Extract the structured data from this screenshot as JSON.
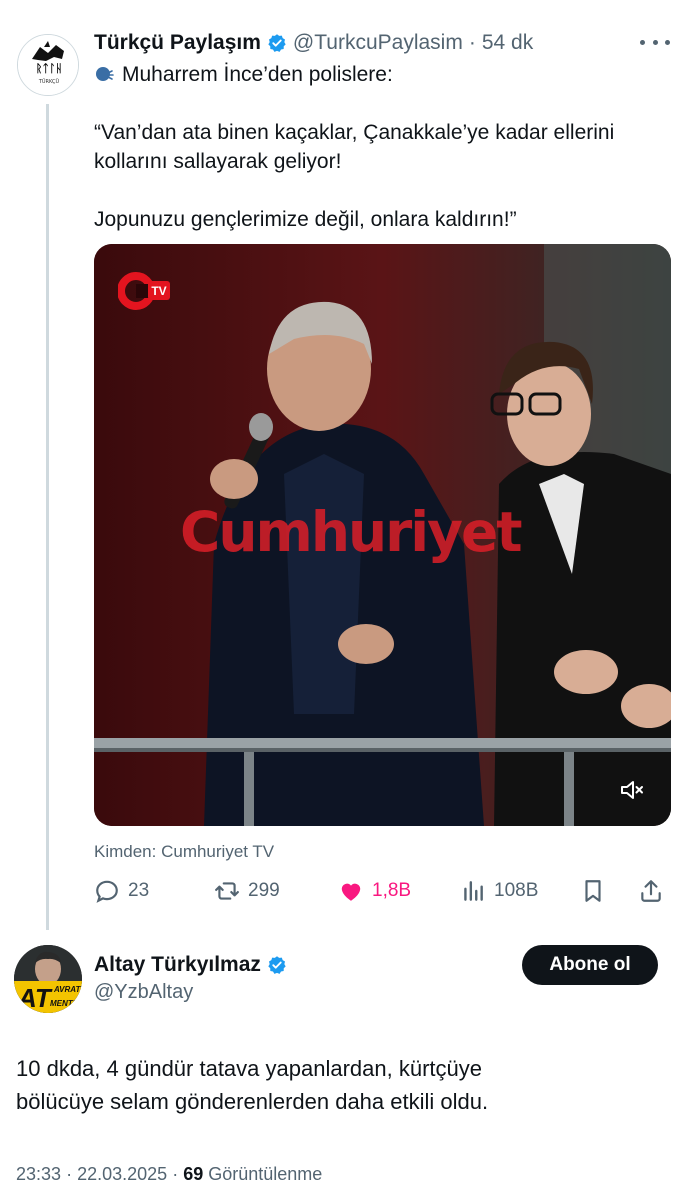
{
  "tweet": {
    "author_name": "Türkçü Paylaşım",
    "handle": "@TurkcuPaylasim",
    "separator": "·",
    "time": "54 dk",
    "avatar_text": "TÜRKÇÜ",
    "text_lines": [
      "Muharrem İnce’den polislere:",
      "",
      "“Van’dan ata binen kaçaklar, Çanakkale’ye kadar ellerini",
      "kollarını sallayarak geliyor!",
      "",
      "Jopunuzu gençlerimize değil, onlara kaldırın!”"
    ],
    "media": {
      "channel_logo_text": "TV",
      "watermark": "Cumhuriyet"
    },
    "source": "Kimden: Cumhuriyet TV",
    "actions": {
      "replies": "23",
      "reposts": "299",
      "likes": "1,8B",
      "views": "108B"
    },
    "colors": {
      "like": "#f91880",
      "verified": "#1d9bf0",
      "muted": "#536471"
    }
  },
  "quote_tweet": {
    "author_name": "Altay Türkyılmaz",
    "handle": "@YzbAltay",
    "follow_label": "Abone ol",
    "avatar_text": {
      "big": "AT",
      "top": "AVRAT",
      "bottom": "MENTION"
    },
    "body_lines": [
      "10 dkda, 4 gündür tatava yapanlardan, kürtçüye",
      "bölücüye selam gönderenlerden daha etkili oldu."
    ],
    "time": "23:33",
    "date": "22.03.2025",
    "separator": "·",
    "views_count": "69",
    "views_label": "Görüntülenme"
  }
}
